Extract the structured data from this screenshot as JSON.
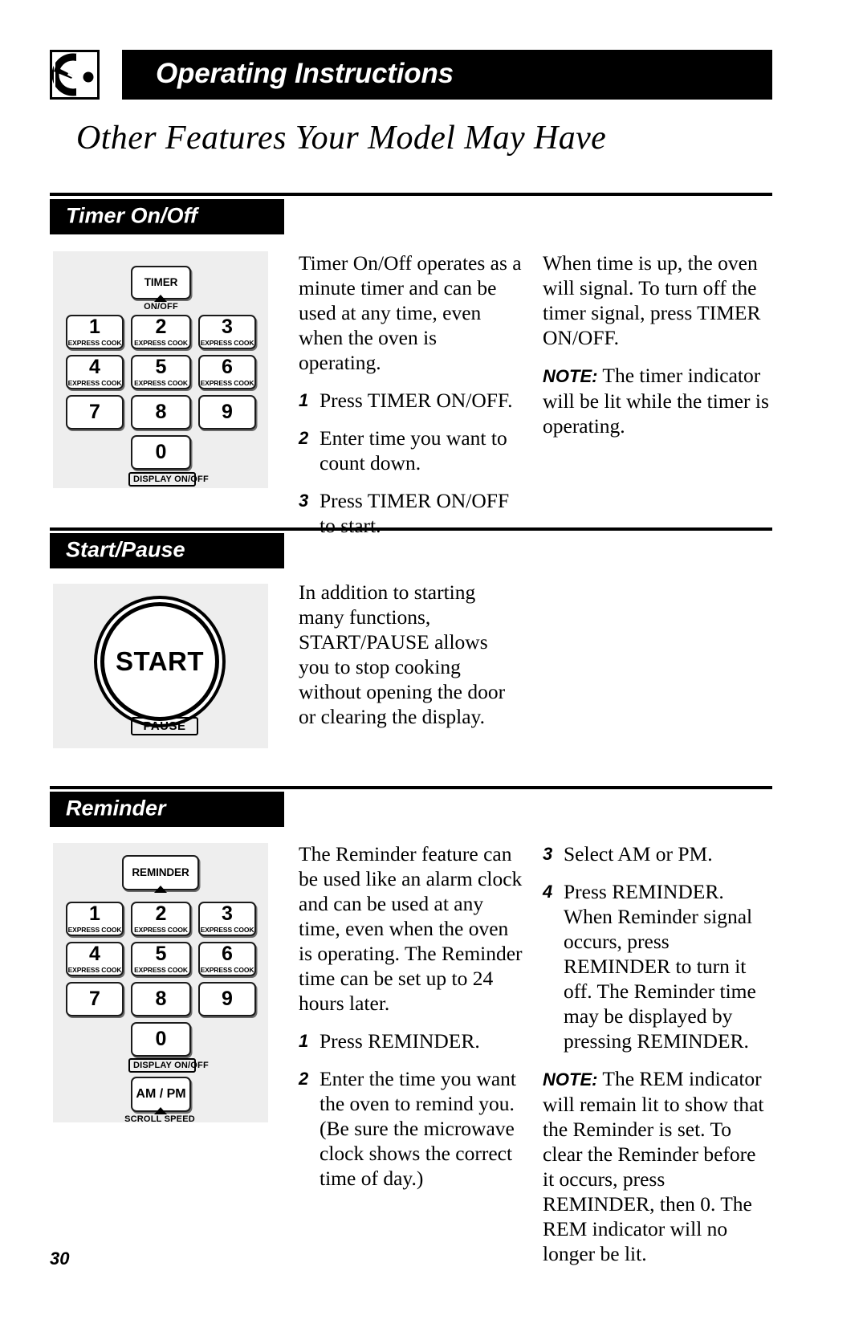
{
  "header": {
    "logo_icon": "knob-dial-icon",
    "title": "Operating Instructions",
    "subtitle": "Other Features Your Model May Have"
  },
  "keypad": {
    "keys": [
      {
        "num": "1",
        "sub": "EXPRESS COOK"
      },
      {
        "num": "2",
        "sub": "EXPRESS COOK"
      },
      {
        "num": "3",
        "sub": "EXPRESS COOK"
      },
      {
        "num": "4",
        "sub": "EXPRESS COOK"
      },
      {
        "num": "5",
        "sub": "EXPRESS COOK"
      },
      {
        "num": "6",
        "sub": "EXPRESS COOK"
      },
      {
        "num": "7",
        "sub": ""
      },
      {
        "num": "8",
        "sub": ""
      },
      {
        "num": "9",
        "sub": ""
      },
      {
        "num": "0",
        "sub": ""
      }
    ],
    "display_caption": "DISPLAY ON/OFF",
    "ampm_label": "AM / PM",
    "scroll_caption": "SCROLL SPEED"
  },
  "sections": [
    {
      "id": "timer",
      "heading": "Timer On/Off",
      "key_label": "TIMER",
      "key_caption": "ON/OFF",
      "left_column": {
        "intro": "Timer On/Off operates as a minute timer and can be used at any time, even when the oven is operating.",
        "steps": [
          {
            "n": "1",
            "text": "Press TIMER ON/OFF."
          },
          {
            "n": "2",
            "text": "Enter time you want to count down."
          },
          {
            "n": "3",
            "text": "Press TIMER ON/OFF to start."
          }
        ]
      },
      "right_column": {
        "paragraph": "When time is up, the oven will signal. To turn off the timer signal, press TIMER ON/OFF.",
        "note_label": "NOTE:",
        "note_text": " The timer indicator will be lit while the timer is operating."
      }
    },
    {
      "id": "start-pause",
      "heading": "Start/Pause",
      "start_label": "START",
      "pause_caption": "PAUSE",
      "left_column": {
        "intro": "In addition to starting many functions, START/PAUSE allows you to stop cooking without opening the door or clearing the display."
      }
    },
    {
      "id": "reminder",
      "heading": "Reminder",
      "key_label": "REMINDER",
      "left_column": {
        "intro": "The Reminder feature can be used like an alarm clock and can be used at any time, even when the oven is operating. The Reminder time can be set up to 24 hours later.",
        "steps": [
          {
            "n": "1",
            "text": "Press REMINDER."
          },
          {
            "n": "2",
            "text": "Enter the time you want the oven to remind you. (Be sure the microwave clock shows the correct time of day.)"
          }
        ]
      },
      "right_column": {
        "steps": [
          {
            "n": "3",
            "text": "Select AM or PM."
          },
          {
            "n": "4",
            "text": "Press REMINDER. When Reminder signal occurs, press REMINDER to turn it off. The Reminder time may be displayed by pressing REMINDER."
          }
        ],
        "note_label": "NOTE:",
        "note_text": " The REM indicator will remain lit to show that the Reminder is set. To clear the Reminder before it occurs, press REMINDER, then 0. The REM indicator will no longer be lit."
      }
    }
  ],
  "footer": {
    "page_number": "30"
  }
}
